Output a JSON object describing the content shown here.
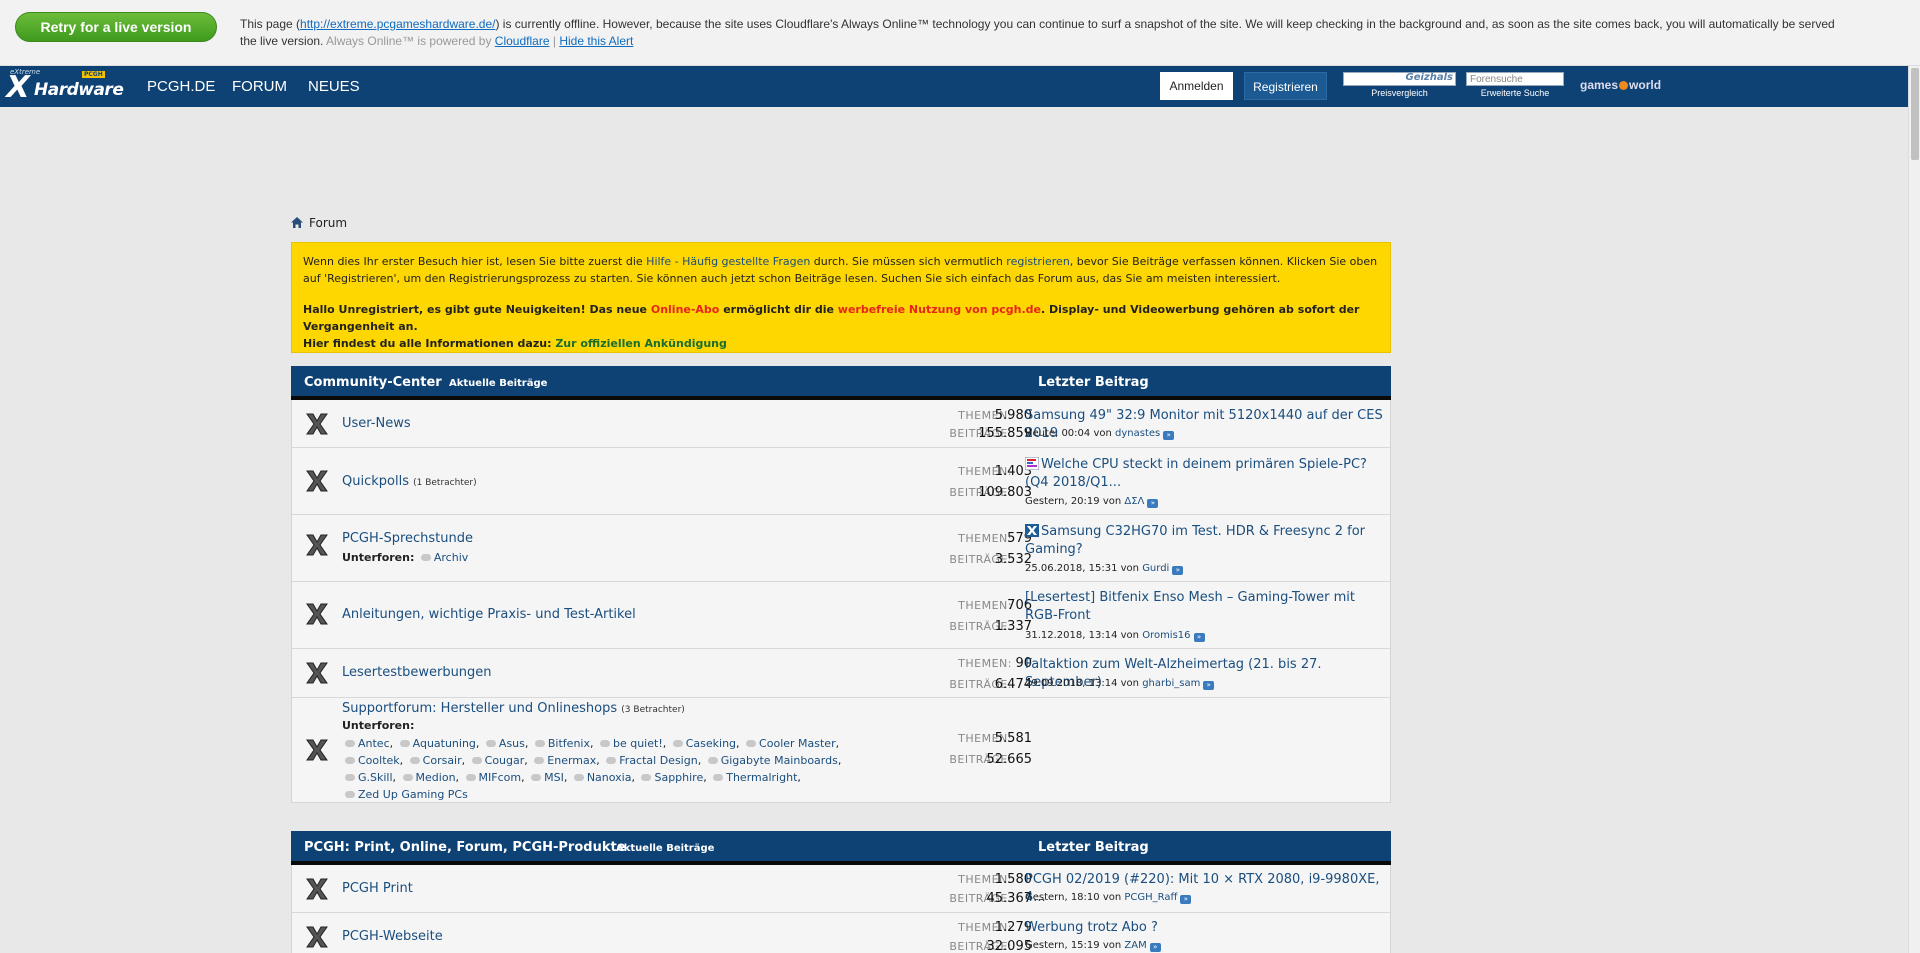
{
  "cloudflare": {
    "retry_button": "Retry for a live version",
    "msg_prefix": "This page (",
    "msg_url": "http://extreme.pcgameshardware.de/",
    "msg_middle": ") is currently offline. However, because the site uses Cloudflare's Always Online™ technology you can continue to surf a snapshot of the site. We will keep checking in the background and, as soon as the site comes back, you will automatically be served the live version.",
    "powered_by": "Always Online™ is powered by",
    "cloudflare_link": "Cloudflare",
    "separator": "|",
    "hide_alert": "Hide this Alert"
  },
  "header": {
    "logo_small": "eXtreme",
    "logo_main": "Hardware",
    "logo_badge": "PCGH",
    "nav": [
      "PCGH.DE",
      "FORUM",
      "NEUES"
    ],
    "login": "Anmelden",
    "register": "Registrieren",
    "geizhals_label": "Preisvergleich",
    "geizhals_brand": "Geizhals",
    "forum_search_placeholder": "Forensuche",
    "forum_search_label": "Erweiterte Suche",
    "gamesworld_a": "games",
    "gamesworld_b": "world"
  },
  "breadcrumb": {
    "label": "Forum"
  },
  "notice": {
    "p1_a": "Wenn dies Ihr erster Besuch hier ist, lesen Sie bitte zuerst die ",
    "p1_link1": "Hilfe - Häufig gestellte Fragen",
    "p1_b": " durch. Sie müssen sich vermutlich ",
    "p1_link2": "registrieren",
    "p1_c": ", bevor Sie Beiträge verfassen können. Klicken Sie oben auf 'Registrieren', um den Registrierungsprozess zu starten. Sie können auch jetzt schon Beiträge lesen. Suchen Sie sich einfach das Forum aus, das Sie am meisten interessiert.",
    "p2_a": "Hallo Unregistriert, es gibt gute Neuigkeiten! Das neue ",
    "p2_red1": "Online-Abo",
    "p2_b": " ermöglicht dir die ",
    "p2_red2": "werbefreie Nutzung von pcgh.de",
    "p2_c": ". Display- und Videowerbung gehören ab sofort der Vergangenheit an.",
    "p2_d": "Hier findest du alle Informationen dazu: ",
    "p2_link": "Zur offiziellen Ankündigung"
  },
  "labels": {
    "themen": "THEMEN:",
    "beitraege": "BEITRÄGE:",
    "unterforen": "Unterforen:",
    "von": "von",
    "last_post": "Letzter Beitrag",
    "aktuelle": "Aktuelle Beiträge"
  },
  "section1": {
    "title": "Community-Center",
    "rows": [
      {
        "name": "User-News",
        "themen": "5.980",
        "beitraege": "155.859",
        "lp_title": "Samsung 49\" 32:9 Monitor mit 5120x1440 auf der CES 2019",
        "lp_date": "Heute, 00:04",
        "lp_user": "dynastes"
      },
      {
        "name": "Quickpolls",
        "viewers": "(1 Betrachter)",
        "themen": "1.403",
        "beitraege": "109.803",
        "lp_title": "Welche CPU steckt in deinem primären Spiele-PC? (Q4 2018/Q1...",
        "lp_date": "Gestern, 20:19",
        "lp_user": "ΔΣΛ"
      },
      {
        "name": "PCGH-Sprechstunde",
        "sub": [
          "Archiv"
        ],
        "themen": "579",
        "beitraege": "3.532",
        "lp_title": "Samsung C32HG70 im Test. HDR & Freesync 2 for Gaming?",
        "lp_date": "25.06.2018, 15:31",
        "lp_user": "Gurdi"
      },
      {
        "name": "Anleitungen, wichtige Praxis- und Test-Artikel",
        "themen": "706",
        "beitraege": "1.337",
        "lp_title": "[Lesertest] Bitfenix Enso Mesh – Gaming-Tower mit RGB-Front",
        "lp_date": "31.12.2018, 13:14",
        "lp_user": "Oromis16"
      },
      {
        "name": "Lesertestbewerbungen",
        "themen": "90",
        "beitraege": "6.474",
        "lp_title": "Faltaktion zum Welt-Alzheimertag (21. bis 27. September)",
        "lp_date": "29.09.2018, 13:14",
        "lp_user": "gharbi_sam"
      },
      {
        "name": "Supportforum: Hersteller und Onlineshops",
        "viewers": "(3 Betrachter)",
        "themen": "5.581",
        "beitraege": "52.665",
        "sub_lines": [
          [
            "Antec",
            "Aquatuning",
            "Asus",
            "Bitfenix",
            "be quiet!",
            "Caseking",
            "Cooler Master"
          ],
          [
            "Cooltek",
            "Corsair",
            "Cougar",
            "Enermax",
            "Fractal Design",
            "Gigabyte Mainboards"
          ],
          [
            "G.Skill",
            "Medion",
            "MIFcom",
            "MSI",
            "Nanoxia",
            "Sapphire",
            "Thermalright"
          ],
          [
            "Zed Up Gaming PCs"
          ]
        ]
      }
    ]
  },
  "section2": {
    "title": "PCGH: Print, Online, Forum, PCGH-Produkte",
    "rows": [
      {
        "name": "PCGH Print",
        "themen": "1.580",
        "beitraege": "45.367",
        "lp_title": "PCGH 02/2019 (#220): Mit 10 × RTX 2080, i9-9980XE, 4...",
        "lp_date": "Gestern, 18:10",
        "lp_user": "PCGH_Raff"
      },
      {
        "name": "PCGH-Webseite",
        "themen": "1.279",
        "beitraege": "32.095",
        "lp_title": "Werbung trotz Abo ?",
        "lp_date": "Gestern, 15:19",
        "lp_user": "ZAM"
      }
    ]
  },
  "colors": {
    "header_bg": "#0e4274",
    "notice_bg": "#ffd700",
    "link": "#1a4e7f",
    "retry_green": "#4fa82a"
  }
}
